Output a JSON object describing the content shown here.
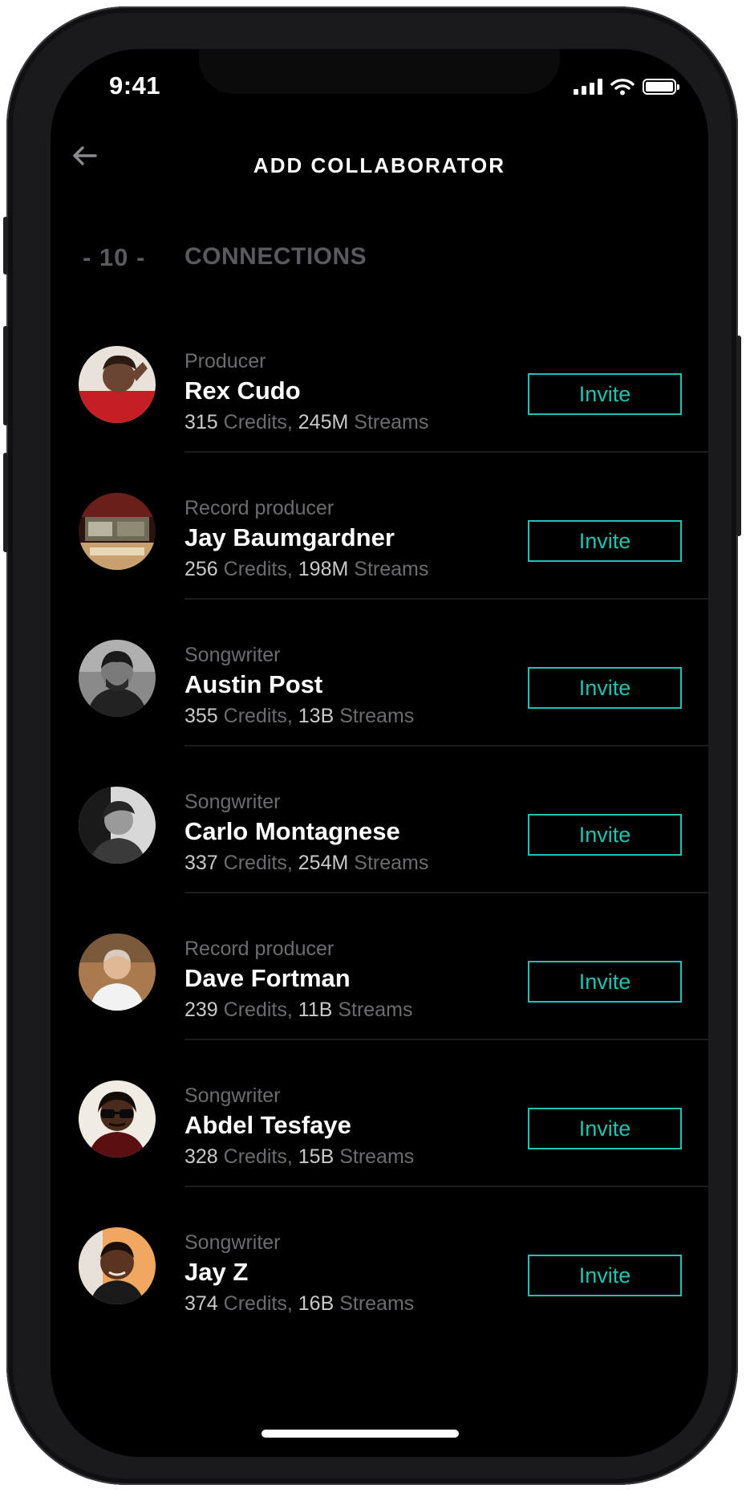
{
  "status_bar": {
    "time": "9:41",
    "icons": [
      "signal-icon",
      "wifi-icon",
      "battery-icon"
    ]
  },
  "nav": {
    "back_icon": "back-arrow-icon",
    "title": "ADD COLLABORATOR"
  },
  "section": {
    "count": "- 10 -",
    "title": "CONNECTIONS"
  },
  "colors": {
    "background": "#000000",
    "accent": "#1ec3b3",
    "muted_text": "#6c6c70",
    "primary_text": "#ffffff"
  },
  "connections": [
    {
      "role": "Producer",
      "name": "Rex Cudo",
      "credits": "315",
      "credits_label": "Credits,",
      "streams": "245M",
      "streams_label": "Streams",
      "invite_label": "Invite"
    },
    {
      "role": "Record producer",
      "name": "Jay Baumgardner",
      "credits": "256",
      "credits_label": "Credits,",
      "streams": "198M",
      "streams_label": "Streams",
      "invite_label": "Invite"
    },
    {
      "role": "Songwriter",
      "name": "Austin Post",
      "credits": "355",
      "credits_label": "Credits,",
      "streams": "13B",
      "streams_label": "Streams",
      "invite_label": "Invite"
    },
    {
      "role": "Songwriter",
      "name": "Carlo Montagnese",
      "credits": "337",
      "credits_label": "Credits,",
      "streams": "254M",
      "streams_label": "Streams",
      "invite_label": "Invite"
    },
    {
      "role": "Record producer",
      "name": "Dave Fortman",
      "credits": "239",
      "credits_label": "Credits,",
      "streams": "11B",
      "streams_label": "Streams",
      "invite_label": "Invite"
    },
    {
      "role": "Songwriter",
      "name": "Abdel Tesfaye",
      "credits": "328",
      "credits_label": "Credits,",
      "streams": "15B",
      "streams_label": "Streams",
      "invite_label": "Invite"
    },
    {
      "role": "Songwriter",
      "name": "Jay Z",
      "credits": "374",
      "credits_label": "Credits,",
      "streams": "16B",
      "streams_label": "Streams",
      "invite_label": "Invite"
    }
  ]
}
